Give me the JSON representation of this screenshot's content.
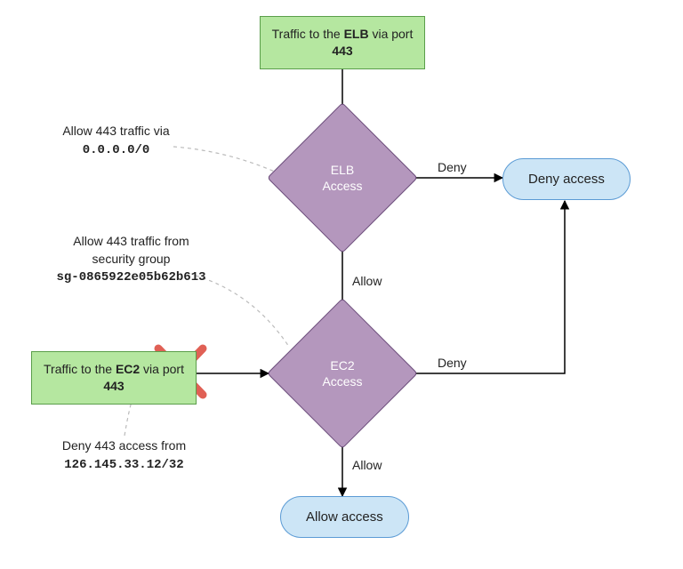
{
  "start_elb": {
    "prefix": "Traffic to the ",
    "bold1": "ELB",
    "mid": " via port ",
    "bold2": "443"
  },
  "start_ec2": {
    "prefix": "Traffic to the ",
    "bold1": "EC2",
    "mid": " via port ",
    "bold2": "443"
  },
  "decision_elb": {
    "line1": "ELB",
    "line2": "Access"
  },
  "decision_ec2": {
    "line1": "EC2",
    "line2": "Access"
  },
  "terminal_allow": "Allow access",
  "terminal_deny": "Deny access",
  "ann_elb_rule": {
    "line1": "Allow 443 traffic via",
    "code": "0.0.0.0/0"
  },
  "ann_ec2_rule": {
    "line1": "Allow 443 traffic from",
    "line2": "security group",
    "code": "sg-0865922e05b62b613"
  },
  "ann_deny_rule": {
    "line1": "Deny 443 access from",
    "code": "126.145.33.12/32"
  },
  "edge_allow": "Allow",
  "edge_deny": "Deny"
}
